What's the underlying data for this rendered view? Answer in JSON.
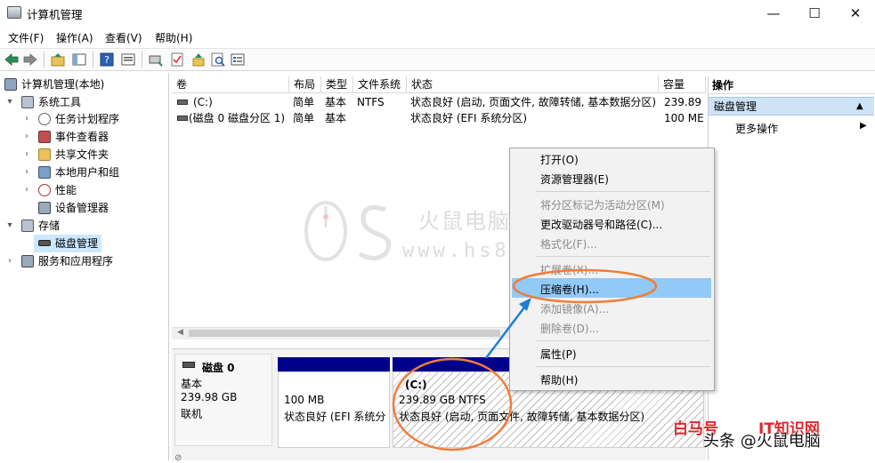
{
  "window": {
    "title": "计算机管理",
    "minimize_glyph": "—",
    "maximize_glyph": "☐",
    "close_glyph": "✕"
  },
  "menu": [
    "文件(F)",
    "操作(A)",
    "查看(V)",
    "帮助(H)"
  ],
  "toolbar_icons": [
    "back-arrow-icon",
    "forward-arrow-icon",
    "up-folder-icon",
    "show-hide-tree-icon",
    "help-icon",
    "properties-icon",
    "connect-icon",
    "check-icon",
    "export-icon",
    "search-icon",
    "view-icon"
  ],
  "tree": {
    "root": "计算机管理(本地)",
    "system_tools": "系统工具",
    "task_scheduler": "任务计划程序",
    "event_viewer": "事件查看器",
    "shared_folders": "共享文件夹",
    "local_users": "本地用户和组",
    "performance": "性能",
    "device_manager": "设备管理器",
    "storage": "存储",
    "disk_management": "磁盘管理",
    "services_apps": "服务和应用程序"
  },
  "table": {
    "headers": [
      "卷",
      "布局",
      "类型",
      "文件系统",
      "状态",
      "容量"
    ],
    "rows": [
      [
        "(C:)",
        "简单",
        "基本",
        "NTFS",
        "状态良好 (启动, 页面文件, 故障转储, 基本数据分区)",
        "239.89"
      ],
      [
        "(磁盘 0 磁盘分区 1)",
        "简单",
        "基本",
        "",
        "状态良好 (EFI 系统分区)",
        "100 ME"
      ]
    ]
  },
  "disk": {
    "name": "磁盘 0",
    "type": "基本",
    "size": "239.98 GB",
    "status": "联机",
    "partitions": [
      {
        "label": "",
        "size": "100 MB",
        "status": "状态良好 (EFI 系统分"
      },
      {
        "label": "(C:)",
        "size": "239.89 GB NTFS",
        "status": "状态良好 (启动, 页面文件, 故障转储, 基本数据分区)"
      }
    ]
  },
  "actions": {
    "header": "操作",
    "section": "磁盘管理",
    "more": "更多操作",
    "up_glyph": "▲",
    "more_glyph": "▶"
  },
  "context_menu": [
    {
      "label": "打开(O)",
      "disabled": false
    },
    {
      "label": "资源管理器(E)",
      "disabled": false
    },
    {
      "label": "将分区标记为活动分区(M)",
      "disabled": true
    },
    {
      "label": "更改驱动器号和路径(C)...",
      "disabled": false
    },
    {
      "label": "格式化(F)...",
      "disabled": true
    },
    {
      "label": "扩展卷(X)...",
      "disabled": true
    },
    {
      "label": "压缩卷(H)...",
      "disabled": false,
      "highlighted": true
    },
    {
      "label": "添加镜像(A)...",
      "disabled": true
    },
    {
      "label": "删除卷(D)...",
      "disabled": true
    },
    {
      "label": "属性(P)",
      "disabled": false
    },
    {
      "label": "帮助(H)",
      "disabled": false
    }
  ],
  "watermark": {
    "cn": "火鼠电脑",
    "url": "www.hs89.cn"
  },
  "branding": {
    "left": "白马号",
    "right": "IT知识网",
    "caption": "头条 @火鼠电脑"
  },
  "colors": {
    "selection": "#cce8ff",
    "partition_bar": "#00008b",
    "menu_highlight": "#91c9f7",
    "annotation": "#f07d3c",
    "arrow": "#1e7fd6",
    "brand_red": "#e0282e"
  }
}
